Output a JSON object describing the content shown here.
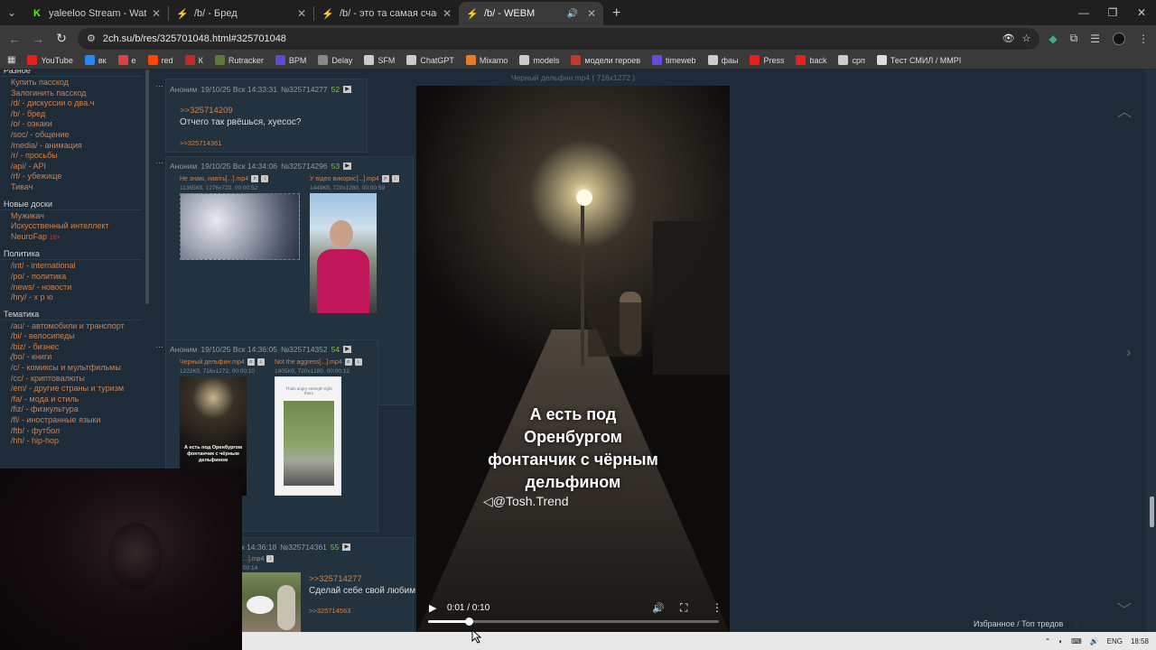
{
  "tabs": [
    {
      "title": "yaleeloo Stream - Watch Live o",
      "fav": "K",
      "fav_color": "#53fc18",
      "active": false
    },
    {
      "title": "/b/ - Бред",
      "fav": "⚡",
      "fav_color": "#e8a04a",
      "active": false
    },
    {
      "title": "/b/ - это та самая счастливая",
      "fav": "⚡",
      "fav_color": "#e8a04a",
      "active": false
    },
    {
      "title": "/b/ - WEBM",
      "fav": "⚡",
      "fav_color": "#e8a04a",
      "active": true
    }
  ],
  "url": "2ch.su/b/res/325701048.html#325701048",
  "bookmarks": [
    {
      "label": "YouTube",
      "color": "#e62117"
    },
    {
      "label": "вк",
      "color": "#2787f5"
    },
    {
      "label": "е",
      "color": "#e04040"
    },
    {
      "label": "red",
      "color": "#ff4500"
    },
    {
      "label": "К",
      "color": "#c62828"
    },
    {
      "label": "Rutracker",
      "color": "#5a7a3a"
    },
    {
      "label": "BPM",
      "color": "#5b4bd8"
    },
    {
      "label": "Delay",
      "color": "#888888"
    },
    {
      "label": "SFM",
      "color": "#cccccc"
    },
    {
      "label": "ChatGPT",
      "color": "#cccccc"
    },
    {
      "label": "Mixamo",
      "color": "#e87b25"
    },
    {
      "label": "models",
      "color": "#cccccc"
    },
    {
      "label": "модели героев",
      "color": "#c0392b"
    },
    {
      "label": "timeweb",
      "color": "#6a4bd8"
    },
    {
      "label": "фаы",
      "color": "#cccccc"
    },
    {
      "label": "Press",
      "color": "#e62117"
    },
    {
      "label": "back",
      "color": "#e62117"
    },
    {
      "label": "срп",
      "color": "#cccccc"
    },
    {
      "label": "Тест СМИЛ / MMPI",
      "color": "#dddddd"
    }
  ],
  "sidebar": [
    {
      "head": "Разное",
      "items": [
        {
          "code": "",
          "desc": "Купить пасскод"
        },
        {
          "code": "",
          "desc": "Залогинить пасскод"
        },
        {
          "code": "/d/",
          "desc": " - дискуссии о два.ч"
        },
        {
          "code": "/b/",
          "desc": " - бред"
        },
        {
          "code": "/o/",
          "desc": " - оэкаки"
        },
        {
          "code": "/soc/",
          "desc": " - общение"
        },
        {
          "code": "/media/",
          "desc": " - анимация"
        },
        {
          "code": "/r/",
          "desc": " - просьбы"
        },
        {
          "code": "/api/",
          "desc": " - API"
        },
        {
          "code": "/rf/",
          "desc": " - убежище"
        },
        {
          "code": "",
          "desc": "Тивач"
        }
      ]
    },
    {
      "head": "Новые доски",
      "items": [
        {
          "code": "",
          "desc": "Мужикач"
        },
        {
          "code": "",
          "desc": "Искусственный интеллект"
        },
        {
          "code": "",
          "desc": "NeuroFap",
          "tag": "18+"
        }
      ]
    },
    {
      "head": "Политика",
      "items": [
        {
          "code": "/int/",
          "desc": " - international"
        },
        {
          "code": "/po/",
          "desc": " - политика"
        },
        {
          "code": "/news/",
          "desc": " - новости"
        },
        {
          "code": "/hry/",
          "desc": " - х р ю"
        }
      ]
    },
    {
      "head": "Тематика",
      "items": [
        {
          "code": "/au/",
          "desc": " - автомобили и транспорт"
        },
        {
          "code": "/bi/",
          "desc": " - велосипеды"
        },
        {
          "code": "/biz/",
          "desc": " - бизнес"
        },
        {
          "code": "/bo/",
          "desc": " - книги"
        },
        {
          "code": "/c/",
          "desc": " - комиксы и мультфильмы"
        },
        {
          "code": "/cc/",
          "desc": " - криптовалюты"
        },
        {
          "code": "/em/",
          "desc": " - другие страны и туризм"
        },
        {
          "code": "/fa/",
          "desc": " - мода и стиль"
        },
        {
          "code": "/fiz/",
          "desc": " - физкультура"
        },
        {
          "code": "/fl/",
          "desc": " - иностранные языки"
        },
        {
          "code": "/ftb/",
          "desc": " - футбол"
        },
        {
          "code": "/hh/",
          "desc": " - hip-hop"
        }
      ]
    }
  ],
  "posts": {
    "p52": {
      "author": "Аноним",
      "date": "19/10/25 Вск 14:33:31",
      "id": "№325714277",
      "num": "52",
      "reply": ">>325714209",
      "text": "Отчего так рвёшься, хуесос?",
      "backlink": ">>325714361"
    },
    "p53": {
      "author": "Аноним",
      "date": "19/10/25 Вск 14:34:06",
      "id": "№325714296",
      "num": "53",
      "files": [
        {
          "name": "Не знаю, навіть[...].mp4",
          "meta": "11365Кб, 1276x720, 00:00:52"
        },
        {
          "name": "У відео викорис[...].mp4",
          "meta": "1449Кб, 720x1280, 00:00:59"
        }
      ]
    },
    "p54": {
      "author": "Аноним",
      "date": "19/10/25 Вск 14:36:05",
      "id": "№325714352",
      "num": "54",
      "files": [
        {
          "name": "Черный дельфин.mp4",
          "meta": "1222Кб, 716x1272, 00:00:10"
        },
        {
          "name": "Not the aggress[...].mp4",
          "meta": "1905Кб, 720x1280, 00:00:12"
        }
      ],
      "thumb_text": "А есть под Оренбургом фонтанчик с чёрным дельфином",
      "thumb2_text": "Thats angry strength right there"
    },
    "p55": {
      "date_tail": "к 14:36:18",
      "id": "№325714361",
      "num": "55",
      "file_name": "...].mp4",
      "file_meta": "00:14",
      "reply": ">>325714277",
      "text": "Сделай себе свой любим",
      "backlink": ">>325714563"
    }
  },
  "video": {
    "caption": "Черный дельфин.mp4 ( 716x1272 )",
    "overlay_lines": [
      "А есть под",
      "Оренбургом",
      "фонтанчик с чёрным",
      "дельфином"
    ],
    "signature": "◁@Tosh.Trend",
    "time": "0:01 / 0:10",
    "progress": 0.14
  },
  "favorites": "Избранное / Топ тредов",
  "taskbar": {
    "lang": "ENG",
    "time": "18:58"
  }
}
